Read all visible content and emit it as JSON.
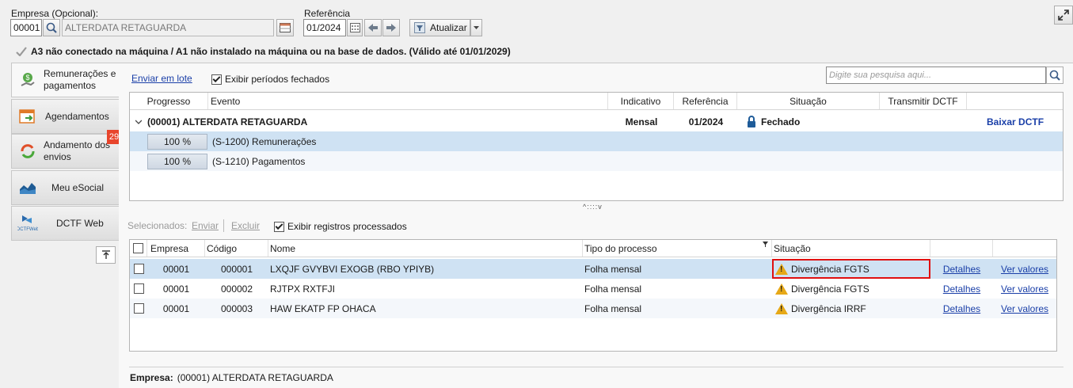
{
  "filters": {
    "empresa_label": "Empresa (Opcional):",
    "empresa_code": "00001",
    "empresa_name": "ALTERDATA RETAGUARDA",
    "referencia_label": "Referência",
    "referencia_value": "01/2024",
    "atualizar_label": "Atualizar"
  },
  "cert_status": "A3 não conectado na máquina / A1 não instalado na máquina ou na base de dados. (Válido até 01/01/2029)",
  "sidebar": {
    "items": [
      {
        "label": "Remunerações e pagamentos",
        "icon": "money-icon"
      },
      {
        "label": "Agendamentos",
        "icon": "calendar-icon"
      },
      {
        "label": "Andamento dos envios",
        "icon": "refresh-icon",
        "badge": "29"
      },
      {
        "label": "Meu eSocial",
        "icon": "chart-icon"
      },
      {
        "label": "DCTF Web",
        "icon": "dctfweb-icon"
      }
    ]
  },
  "top_toolbar": {
    "enviar_em_lote": "Enviar em lote",
    "exibir_periodos_fechados": "Exibir períodos fechados",
    "search_placeholder": "Digite sua pesquisa aqui..."
  },
  "top_grid": {
    "columns": [
      "Progresso",
      "Evento",
      "Indicativo",
      "Referência",
      "Situação",
      "Transmitir DCTF"
    ],
    "group": {
      "name": "(00001) ALTERDATA RETAGUARDA",
      "indicativo": "Mensal",
      "referencia": "01/2024",
      "situacao": "Fechado",
      "acao": "Baixar DCTF"
    },
    "rows": [
      {
        "progresso": "100 %",
        "evento": "(S-1200) Remunerações"
      },
      {
        "progresso": "100 %",
        "evento": "(S-1210) Pagamentos"
      }
    ]
  },
  "bottom_toolbar": {
    "selecionados": "Selecionados:",
    "enviar": "Enviar",
    "excluir": "Excluir",
    "exibir_registros": "Exibir registros processados"
  },
  "bottom_grid": {
    "columns": [
      "Empresa",
      "Código",
      "Nome",
      "Tipo do processo",
      "Situação"
    ],
    "rows": [
      {
        "empresa": "00001",
        "codigo": "000001",
        "nome": "LXQJF GVYBVI EXOGB (RBO YPIYB)",
        "tipo": "Folha mensal",
        "situacao": "Divergência FGTS",
        "detalhes": "Detalhes",
        "ver": "Ver valores"
      },
      {
        "empresa": "00001",
        "codigo": "000002",
        "nome": "RJTPX RXTFJI",
        "tipo": "Folha mensal",
        "situacao": "Divergência FGTS",
        "detalhes": "Detalhes",
        "ver": "Ver valores"
      },
      {
        "empresa": "00001",
        "codigo": "000003",
        "nome": "HAW EKATP FP OHACA",
        "tipo": "Folha mensal",
        "situacao": "Divergência IRRF",
        "detalhes": "Detalhes",
        "ver": "Ver valores"
      }
    ]
  },
  "footer": {
    "empresa_label": "Empresa:",
    "empresa_value": "(00001) ALTERDATA RETAGUARDA"
  },
  "colors": {
    "selected_row": "#cfe2f3",
    "highlight_border": "#e01010",
    "link": "#1a3fa8",
    "badge": "#e8452c"
  }
}
